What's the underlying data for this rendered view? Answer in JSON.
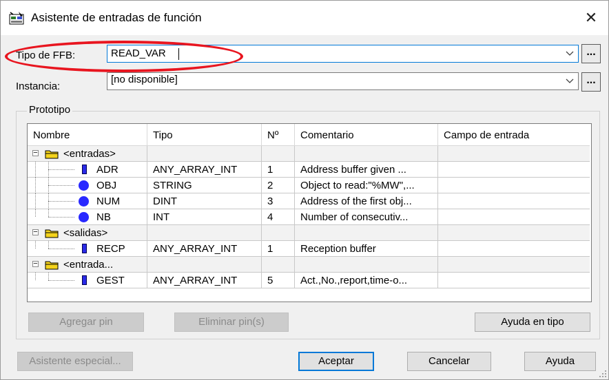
{
  "window": {
    "title": "Asistente de entradas de función",
    "close_glyph": "✕"
  },
  "fields": {
    "ffb_type_label": "Tipo de FFB:",
    "ffb_type_value": "READ_VAR",
    "instance_label": "Instancia:",
    "instance_value": "[no disponible]",
    "browse_label": "..."
  },
  "prototype": {
    "group_label": "Prototipo",
    "columns": [
      "Nombre",
      "Tipo",
      "Nº",
      "Comentario",
      "Campo de entrada"
    ],
    "groups": [
      {
        "label": "<entradas>",
        "expander": "−",
        "rows": [
          {
            "icon": "pin-array-icon",
            "name": "ADR",
            "type": "ANY_ARRAY_INT",
            "num": "1",
            "comment": "Address buffer given ..."
          },
          {
            "icon": "pin-scalar-icon",
            "name": "OBJ",
            "type": "STRING",
            "num": "2",
            "comment": "Object to read:\"%MW\",..."
          },
          {
            "icon": "pin-scalar-icon",
            "name": "NUM",
            "type": "DINT",
            "num": "3",
            "comment": "Address of the first obj..."
          },
          {
            "icon": "pin-scalar-icon",
            "name": "NB",
            "type": "INT",
            "num": "4",
            "comment": "Number of consecutiv..."
          }
        ]
      },
      {
        "label": "<salidas>",
        "expander": "−",
        "rows": [
          {
            "icon": "pin-array-icon",
            "name": "RECP",
            "type": "ANY_ARRAY_INT",
            "num": "1",
            "comment": "Reception buffer"
          }
        ]
      },
      {
        "label": "<entrada...",
        "expander": "−",
        "rows": [
          {
            "icon": "pin-array-icon",
            "name": "GEST",
            "type": "ANY_ARRAY_INT",
            "num": "5",
            "comment": "Act.,No.,report,time-o..."
          }
        ]
      }
    ]
  },
  "buttons": {
    "add_pin": "Agregar pin",
    "remove_pin": "Eliminar pin(s)",
    "type_help": "Ayuda en tipo",
    "special_wizard": "Asistente especial...",
    "accept": "Aceptar",
    "cancel": "Cancelar",
    "help": "Ayuda"
  },
  "colors": {
    "accent": "#0078d7",
    "highlight_oval": "#e8151f",
    "pin_blue": "#2828ff",
    "folder_yellow": "#f4d31c"
  }
}
